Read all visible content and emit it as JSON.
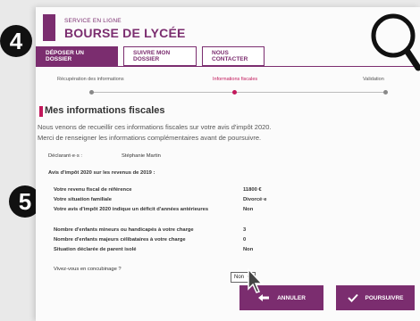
{
  "header": {
    "brand_small": "SERVICE EN LIGNE",
    "brand_big": "BOURSE DE LYCÉE"
  },
  "tabs": [
    {
      "label": "DÉPOSER UN DOSSIER",
      "active": true
    },
    {
      "label": "SUIVRE MON DOSSIER",
      "active": false
    },
    {
      "label": "NOUS CONTACTER",
      "active": false
    }
  ],
  "steps": [
    {
      "label": "Récupération des informations"
    },
    {
      "label": "Informations fiscales"
    },
    {
      "label": "Validation"
    }
  ],
  "section": {
    "title": "Mes informations fiscales",
    "intro_1": "Nous venons de recueillir ces informations fiscales sur votre avis d'impôt 2020.",
    "intro_2": "Merci de renseigner les informations complémentaires avant de poursuivre."
  },
  "declarant": {
    "label": "Déclarant·e·s :",
    "value": "Stéphanie Martin"
  },
  "avis_heading": "Avis d'impôt 2020 sur les revenus de 2019 :",
  "fiscal": [
    {
      "label": "Votre revenu fiscal de référence",
      "value": "11800 €"
    },
    {
      "label": "Votre situation familiale",
      "value": "Divorcé·e"
    },
    {
      "label": "Votre avis d'impôt 2020 indique un déficit d'années antérieures",
      "value": "Non"
    }
  ],
  "children": [
    {
      "label": "Nombre d'enfants mineurs ou handicapés à votre charge",
      "value": "3"
    },
    {
      "label": "Nombre d'enfants majeurs célibataires à votre charge",
      "value": "0"
    },
    {
      "label": "Situation déclarée de parent isolé",
      "value": "Non"
    }
  ],
  "concubinage": {
    "label": "Vivez-vous en concubinage ?",
    "value": "Non"
  },
  "buttons": {
    "cancel": "ANNULER",
    "continue": "POURSUIVRE"
  },
  "badges": {
    "first": "4",
    "second": "5"
  },
  "colors": {
    "brand": "#7b2d6f",
    "accent": "#c2185b"
  }
}
